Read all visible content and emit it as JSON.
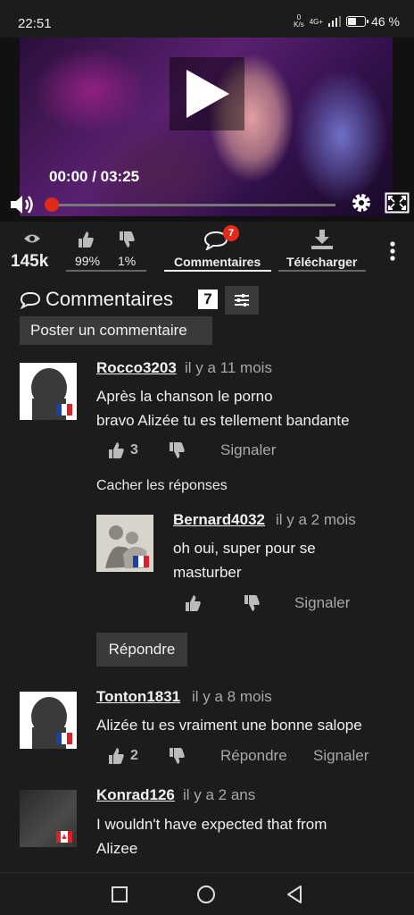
{
  "status": {
    "time": "22:51",
    "speed_top": "0",
    "speed_bottom": "K/s",
    "network": "4G+",
    "battery": "46 %"
  },
  "video": {
    "time": "00:00 / 03:25",
    "progress": 0.0
  },
  "actions": {
    "views": "145k",
    "likes": "99%",
    "dislikes": "1%",
    "comments_badge": "7",
    "comments_label": "Commentaires",
    "download_label": "Télécharger"
  },
  "comments_header": {
    "title": "Commentaires",
    "count": "7",
    "post_button": "Poster un commentaire"
  },
  "comments": [
    {
      "user": "Rocco3203",
      "ago": "il y a 11 mois",
      "lines": [
        "Après la chanson le porno",
        "bravo Alizée tu es tellement bandante"
      ],
      "likes": "3",
      "report": "Signaler",
      "hide_replies": "Cacher les réponses"
    },
    {
      "user": "Bernard4032",
      "ago": "il y a 2 mois",
      "lines": [
        "oh oui, super pour se",
        "masturber"
      ],
      "report": "Signaler"
    },
    {
      "user": "Tonton1831",
      "ago": "il y a 8 mois",
      "lines": [
        "Alizée tu es vraiment une bonne salope"
      ],
      "likes": "2",
      "reply": "Répondre",
      "report": "Signaler"
    },
    {
      "user": "Konrad126",
      "ago": "il y a 2 ans",
      "lines": [
        "I wouldn't have expected that from",
        "Alizee"
      ]
    }
  ],
  "reply_button": "Répondre",
  "colors": {
    "accent": "#e02a1a",
    "background": "#1c1c1c",
    "button": "#3a3a3a"
  }
}
